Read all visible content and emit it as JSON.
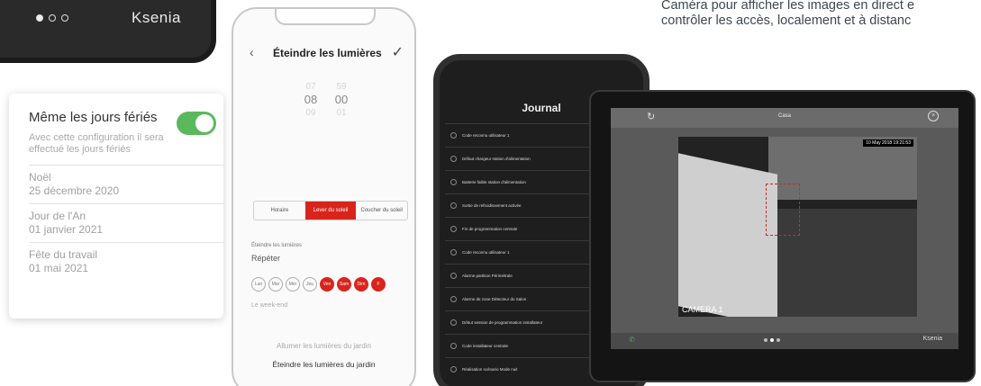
{
  "top_device": {
    "pager_dots": 3,
    "brand": "Ksenia"
  },
  "top_text": {
    "line1": "Caméra pour afficher les images en direct e",
    "line2": "contrôler les accès, localement et à distanc"
  },
  "holiday_card": {
    "title": "Même les jours fériés",
    "toggle_on": true,
    "description": "Avec cette configuration il sera effectué les jours fériés",
    "holidays": [
      {
        "name": "Noël",
        "date": "25 décembre 2020"
      },
      {
        "name": "Jour de l'An",
        "date": "01 janvier 2021"
      },
      {
        "name": "Fête du travail",
        "date": "01 mai 2021"
      }
    ]
  },
  "phone_lights": {
    "title": "Éteindre les lumières",
    "back_icon": "chevron-left-icon",
    "confirm_icon": "checkmark-icon",
    "hours": [
      "07",
      "08",
      "09"
    ],
    "minutes": [
      "59",
      "00",
      "01"
    ],
    "selected_time": {
      "hour": "08",
      "minute": "00"
    },
    "mode_options": [
      "Horaire",
      "Lever du soleil",
      "Coucher du soleil"
    ],
    "active_mode": "Lever du soleil",
    "action_label": "Éteindre les lumières",
    "repeat_label": "Répéter",
    "days": [
      {
        "label": "Lun",
        "active": false
      },
      {
        "label": "Mar",
        "active": false
      },
      {
        "label": "Mer",
        "active": false
      },
      {
        "label": "Jeu",
        "active": false
      },
      {
        "label": "Ven",
        "active": true
      },
      {
        "label": "Sam",
        "active": true
      },
      {
        "label": "Dim",
        "active": true
      },
      {
        "label": "F",
        "active": true
      }
    ],
    "weekend_label": "Le week-end",
    "scenario_1": "Allumer les lumières du jardin",
    "scenario_2": "Éteindre les lumières du jardin"
  },
  "phone_journal": {
    "title": "Journal",
    "entries": [
      "Code reconnu utilisateur 1",
      "Défaut chargeur station d'alimentation",
      "Batterie faible station d'alimentation",
      "Sortie de refroidissement activée",
      "Fin de programmation centrale",
      "Code reconnu utilisateur 1",
      "Alarme partition Périmétrale",
      "Alarme de zone Détecteur du Salon",
      "Début session de programmation installateur",
      "Code installateur centrale",
      "Réalisation scénario Mode nuit"
    ]
  },
  "tablet": {
    "title": "Casa",
    "refresh_icon": "refresh-icon",
    "close_icon": "close-icon",
    "timestamp": "10 May 2018 19:21:53",
    "camera_label": "CAMERA 1",
    "pager_dots": 3,
    "brand": "Ksenia",
    "call_icon": "phone-icon"
  }
}
